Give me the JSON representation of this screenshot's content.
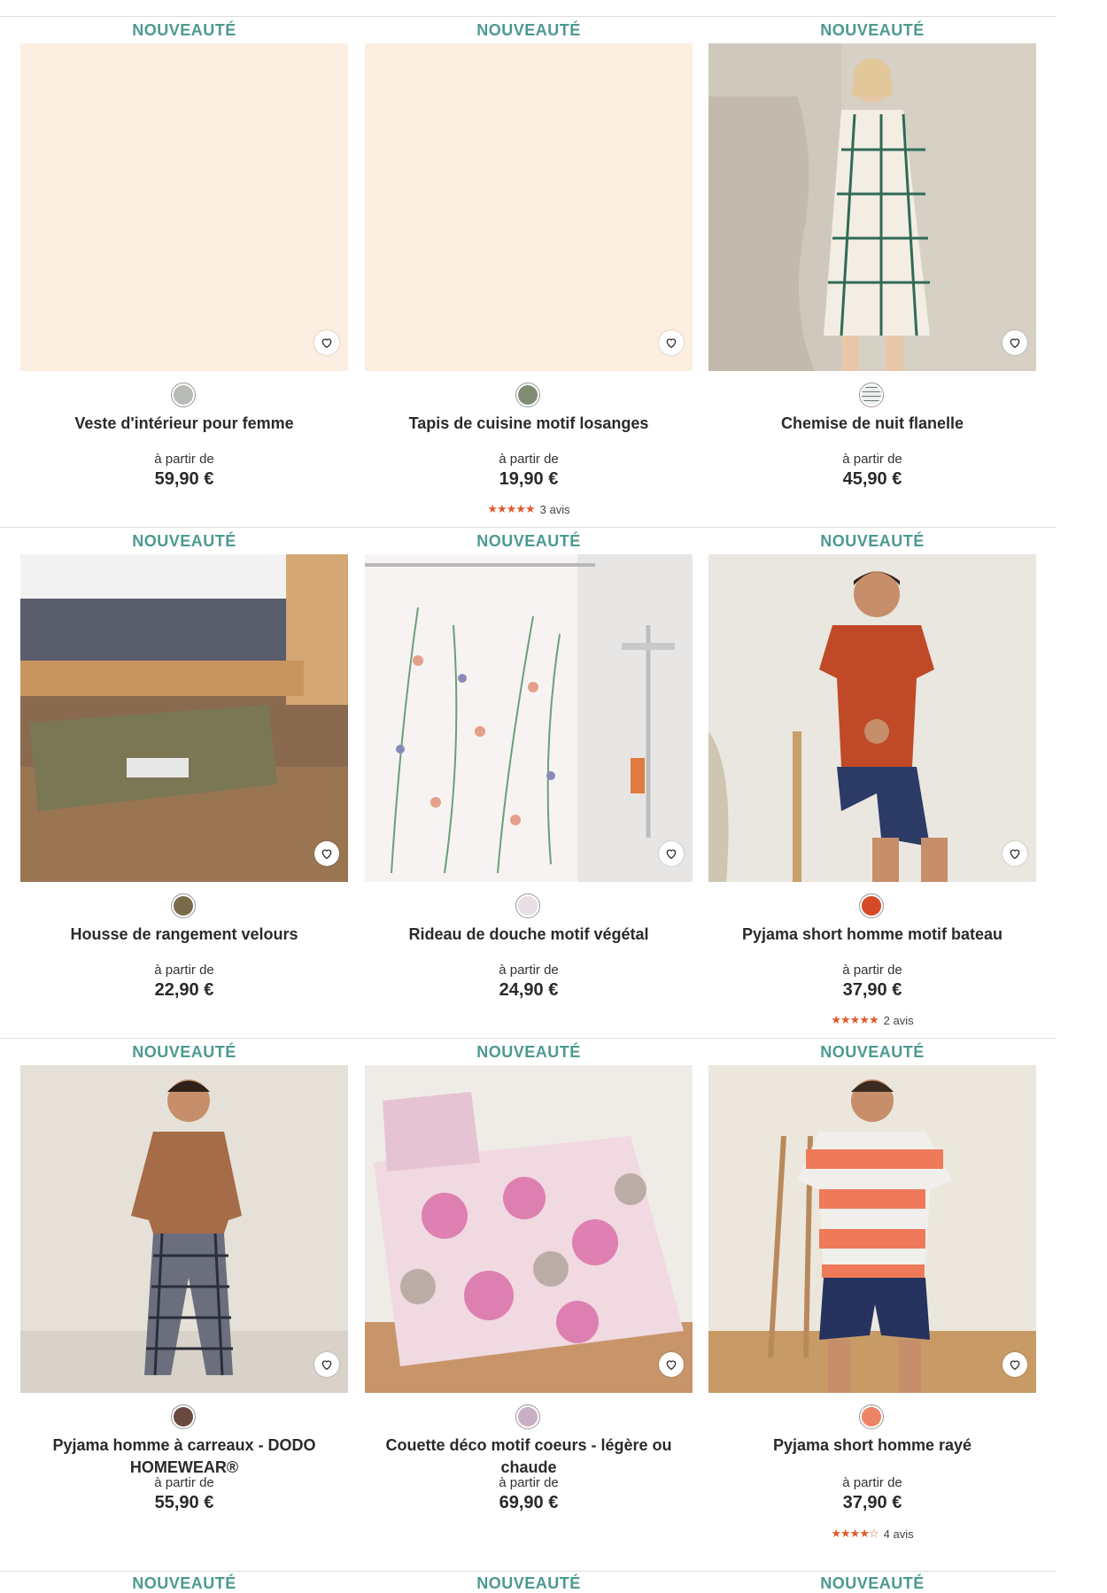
{
  "colors": {
    "badge": "#4c9a91",
    "placeholder": "#fcefe1",
    "star": "#e2592b"
  },
  "products": [
    {
      "badge": "NOUVEAUTÉ",
      "title": "Veste d'intérieur pour femme",
      "from_label": "à partir de",
      "price": "59,90 €",
      "swatch_color": "#b9bbb7",
      "image_icon": "placeholder-image",
      "rating": null
    },
    {
      "badge": "NOUVEAUTÉ",
      "title": "Tapis de cuisine motif losanges",
      "from_label": "à partir de",
      "price": "19,90 €",
      "swatch_color": "#7f8d75",
      "image_icon": "placeholder-image",
      "rating": {
        "stars": 5,
        "count_label": "3 avis"
      }
    },
    {
      "badge": "NOUVEAUTÉ",
      "title": "Chemise de nuit flanelle",
      "from_label": "à partir de",
      "price": "45,90 €",
      "swatch_color": "#8a9a92",
      "image_icon": "woman-nightshirt-photo",
      "rating": null
    },
    {
      "badge": "NOUVEAUTÉ",
      "title": "Housse de rangement velours",
      "from_label": "à partir de",
      "price": "22,90 €",
      "swatch_color": "#7a6b4a",
      "image_icon": "storage-bag-photo",
      "rating": null
    },
    {
      "badge": "NOUVEAUTÉ",
      "title": "Rideau de douche motif végétal",
      "from_label": "à partir de",
      "price": "24,90 €",
      "swatch_color": "#e6dfe6",
      "image_icon": "shower-curtain-photo",
      "rating": null
    },
    {
      "badge": "NOUVEAUTÉ",
      "title": "Pyjama short homme motif bateau",
      "from_label": "à partir de",
      "price": "37,90 €",
      "swatch_color": "#d54a28",
      "image_icon": "man-pyjama-photo",
      "rating": {
        "stars": 5,
        "count_label": "2 avis"
      }
    },
    {
      "badge": "NOUVEAUTÉ",
      "title": "Pyjama homme à carreaux - DODO HOMEWEAR®",
      "from_label": "à partir de",
      "price": "55,90 €",
      "swatch_color": "#6a4a3e",
      "image_icon": "man-plaid-pyjama-photo",
      "rating": null
    },
    {
      "badge": "NOUVEAUTÉ",
      "title": "Couette déco motif coeurs - légère ou chaude",
      "from_label": "à partir de",
      "price": "69,90 €",
      "swatch_color": "#c9aec4",
      "image_icon": "duvet-photo",
      "rating": null
    },
    {
      "badge": "NOUVEAUTÉ",
      "title": "Pyjama short homme rayé",
      "from_label": "à partir de",
      "price": "37,90 €",
      "swatch_color": "#ee8466",
      "image_icon": "man-striped-pyjama-photo",
      "rating": {
        "stars": 4.5,
        "count_label": "4 avis"
      }
    }
  ],
  "next_row_badges": [
    "NOUVEAUTÉ",
    "NOUVEAUTÉ",
    "NOUVEAUTÉ"
  ]
}
